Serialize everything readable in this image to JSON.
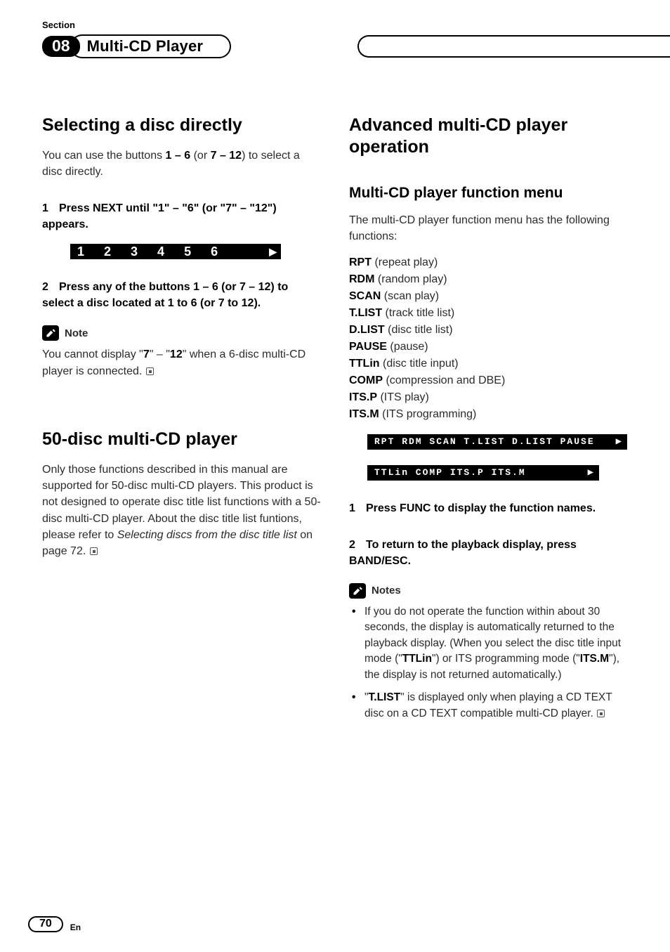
{
  "header": {
    "section_label": "Section",
    "section_number": "08",
    "title": "Multi-CD Player"
  },
  "left": {
    "h1": "Selecting a disc directly",
    "p1_a": "You can use the buttons ",
    "p1_b1": "1 – 6",
    "p1_c": " (or ",
    "p1_b2": "7 – 12",
    "p1_d": ") to select a disc directly.",
    "step1": "Press NEXT until \"1\" – \"6\" (or \"7\" – \"12\") appears.",
    "strip_nums": [
      "1",
      "2",
      "3",
      "4",
      "5",
      "6"
    ],
    "step2": "Press any of the buttons 1 – 6 (or 7 – 12) to select a disc located at 1 to 6 (or 7 to 12).",
    "note_label": "Note",
    "note_a": "You cannot display \"",
    "note_b1": "7",
    "note_b": "\" – \"",
    "note_b2": "12",
    "note_c": "\" when a 6-disc multi-CD player is connected.",
    "h2": "50-disc multi-CD player",
    "p2_a": "Only those functions described in this manual are supported for 50-disc multi-CD players. This product is not designed to operate disc title list functions with a 50-disc multi-CD player. About the disc title list funtions, please refer to ",
    "p2_ref": "Selecting discs from the disc title list",
    "p2_b": " on page 72."
  },
  "right": {
    "h1": "Advanced multi-CD player operation",
    "sub1": "Multi-CD player function menu",
    "intro": "The multi-CD player function menu has the following functions:",
    "funcs": [
      {
        "k": "RPT",
        "d": " (repeat play)"
      },
      {
        "k": "RDM",
        "d": " (random play)"
      },
      {
        "k": "SCAN",
        "d": " (scan play)"
      },
      {
        "k": "T.LIST",
        "d": " (track title list)"
      },
      {
        "k": "D.LIST",
        "d": " (disc title list)"
      },
      {
        "k": "PAUSE",
        "d": " (pause)"
      },
      {
        "k": "TTLin",
        "d": " (disc title input)"
      },
      {
        "k": "COMP",
        "d": " (compression and DBE)"
      },
      {
        "k": "ITS.P",
        "d": " (ITS play)"
      },
      {
        "k": "ITS.M",
        "d": " (ITS programming)"
      }
    ],
    "strip1": "RPT  RDM  SCAN T.LIST D.LIST PAUSE",
    "strip2": "TTLin COMP  ITS.P  ITS.M",
    "step1": "Press FUNC to display the function names.",
    "step2": "To return to the playback display, press BAND/ESC.",
    "notes_label": "Notes",
    "note1_a": "If you do not operate the function within about 30 seconds, the display is automatically returned to the playback display. (When you select the disc title input mode (\"",
    "note1_b1": "TTLin",
    "note1_b": "\") or ITS programming mode (\"",
    "note1_b2": "ITS.M",
    "note1_c": "\"), the display is not returned automatically.)",
    "note2_a": "\"",
    "note2_b1": "T.LIST",
    "note2_b": "\" is displayed only when playing a CD TEXT disc on a CD TEXT compatible multi-CD player."
  },
  "footer": {
    "page": "70",
    "lang": "En"
  }
}
